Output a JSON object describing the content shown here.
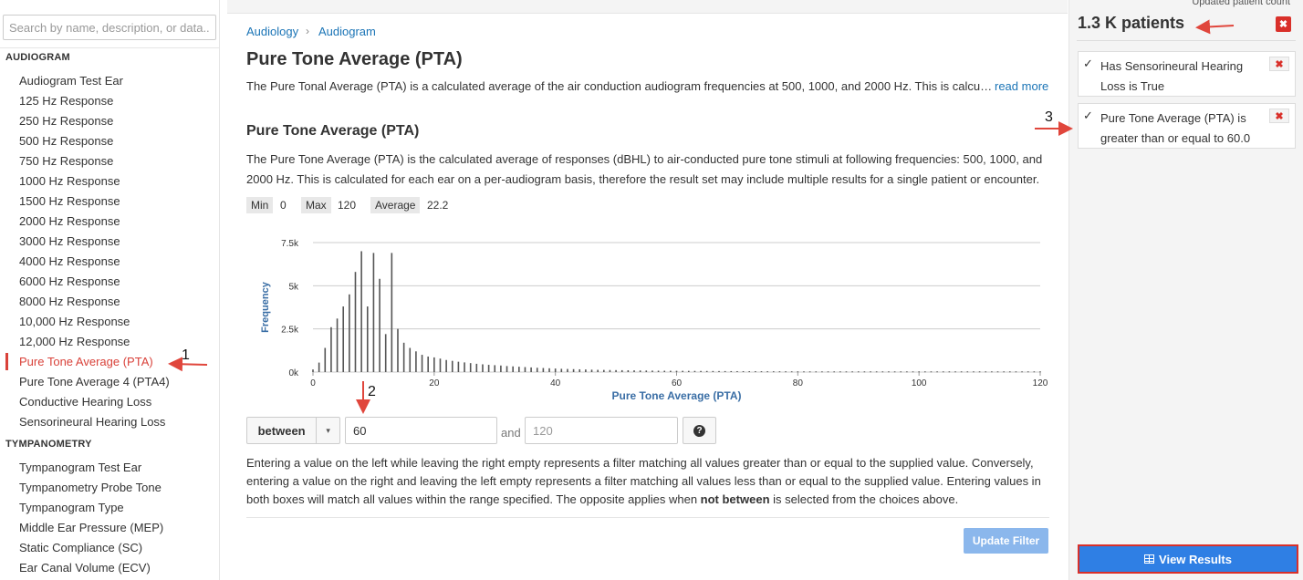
{
  "sidebar": {
    "search_placeholder": "Search by name, description, or data...",
    "sections": [
      {
        "title": "AUDIOGRAM",
        "items": [
          "Audiogram Test Ear",
          "125 Hz Response",
          "250 Hz Response",
          "500 Hz Response",
          "750 Hz Response",
          "1000 Hz Response",
          "1500 Hz Response",
          "2000 Hz Response",
          "3000 Hz Response",
          "4000 Hz Response",
          "6000 Hz Response",
          "8000 Hz Response",
          "10,000 Hz Response",
          "12,000 Hz Response",
          "Pure Tone Average (PTA)",
          "Pure Tone Average 4 (PTA4)",
          "Conductive Hearing Loss",
          "Sensorineural Hearing Loss"
        ]
      },
      {
        "title": "TYMPANOMETRY",
        "items": [
          "Tympanogram Test Ear",
          "Tympanometry Probe Tone",
          "Tympanogram Type",
          "Middle Ear Pressure (MEP)",
          "Static Compliance (SC)",
          "Ear Canal Volume (ECV)"
        ]
      }
    ],
    "active_item": "Pure Tone Average (PTA)"
  },
  "main": {
    "breadcrumb": [
      "Audiology",
      "Audiogram"
    ],
    "breadcrumb_sep": "›",
    "title": "Pure Tone Average (PTA)",
    "summary": "The Pure Tonal Average (PTA) is a calculated average of the air conduction audiogram frequencies at 500, 1000, and 2000 Hz. This is calcu…",
    "read_more": "read more",
    "section_title": "Pure Tone Average (PTA)",
    "description": "The Pure Tone Average (PTA) is the calculated average of responses (dBHL) to air-conducted pure tone stimuli at following frequencies: 500, 1000, and 2000 Hz. This is calculated for each ear on a per-audiogram basis, therefore the result set may include multiple results for a single patient or encounter.",
    "stats": {
      "min_label": "Min",
      "min_value": "0",
      "max_label": "Max",
      "max_value": "120",
      "avg_label": "Average",
      "avg_value": "22.2"
    },
    "filter": {
      "operator": "between",
      "caret": "▾",
      "low_value": "60",
      "high_placeholder": "120",
      "and_label": "and",
      "help_icon": "?"
    },
    "help_text_before": "Entering a value on the left while leaving the right empty represents a filter matching all values greater than or equal to the supplied value. Conversely, entering a value on the right and leaving the left empty represents a filter matching all values less than or equal to the supplied value. Entering values in both boxes will match all values within the range specified. The opposite applies when ",
    "help_text_bold": "not between",
    "help_text_after": " is selected from the choices above.",
    "update_button": "Update Filter"
  },
  "chart_data": {
    "type": "bar",
    "xlabel": "Pure Tone Average (PTA)",
    "ylabel": "Frequency",
    "xlim": [
      0,
      120
    ],
    "ylim": [
      0,
      7500
    ],
    "xticks": [
      0,
      20,
      40,
      60,
      80,
      100,
      120
    ],
    "yticks": [
      0,
      2500,
      5000,
      7500
    ],
    "ytick_labels": [
      "0k",
      "2.5k",
      "5k",
      "7.5k"
    ],
    "grid": true,
    "colors": {
      "bars": "#555555",
      "axis_label": "#3a6ea5",
      "grid": "#cccccc"
    },
    "x": [
      0,
      1,
      2,
      3,
      4,
      5,
      6,
      7,
      8,
      9,
      10,
      11,
      12,
      13,
      14,
      15,
      16,
      17,
      18,
      19,
      20,
      21,
      22,
      23,
      24,
      25,
      26,
      27,
      28,
      29,
      30,
      31,
      32,
      33,
      34,
      35,
      36,
      37,
      38,
      39,
      40,
      41,
      42,
      43,
      44,
      45,
      46,
      47,
      48,
      49,
      50,
      51,
      52,
      53,
      54,
      55,
      56,
      57,
      58,
      59,
      60,
      61,
      62,
      63,
      64,
      65,
      66,
      67,
      68,
      69,
      70,
      71,
      72,
      73,
      74,
      75,
      76,
      77,
      78,
      79,
      80,
      81,
      82,
      83,
      84,
      85,
      86,
      87,
      88,
      89,
      90,
      91,
      92,
      93,
      94,
      95,
      96,
      97,
      98,
      99,
      100,
      101,
      102,
      103,
      104,
      105,
      106,
      107,
      108,
      109,
      110,
      111,
      112,
      113,
      114,
      115,
      116,
      117,
      118,
      119,
      120
    ],
    "values": [
      150,
      550,
      1400,
      2600,
      3100,
      3800,
      4500,
      5800,
      7000,
      3800,
      6900,
      5400,
      2200,
      6900,
      2500,
      1700,
      1400,
      1200,
      1000,
      900,
      850,
      780,
      700,
      650,
      600,
      560,
      520,
      480,
      450,
      420,
      400,
      380,
      350,
      330,
      310,
      290,
      270,
      250,
      235,
      220,
      205,
      190,
      180,
      170,
      160,
      150,
      140,
      130,
      125,
      120,
      115,
      110,
      105,
      100,
      95,
      90,
      85,
      80,
      78,
      76,
      74,
      72,
      70,
      68,
      66,
      64,
      62,
      60,
      58,
      56,
      54,
      52,
      50,
      50,
      48,
      47,
      46,
      45,
      44,
      43,
      42,
      41,
      40,
      40,
      40,
      40,
      40,
      40,
      40,
      40,
      40,
      40,
      40,
      40,
      40,
      40,
      40,
      40,
      40,
      40,
      40,
      40,
      40,
      40,
      40,
      40,
      40,
      40,
      40,
      40,
      40,
      40,
      40,
      40,
      40,
      40,
      40,
      40,
      40,
      40,
      40
    ],
    "bar_x": [
      0,
      1,
      2,
      3,
      4,
      5,
      6,
      7,
      8,
      9,
      10,
      11,
      12,
      13,
      14,
      15,
      16,
      17,
      18,
      19,
      20,
      21,
      22,
      23,
      24,
      25,
      26,
      27,
      28,
      29,
      30,
      31,
      32,
      33,
      34,
      35,
      36,
      37,
      38,
      39,
      40,
      41,
      42,
      43,
      44,
      45,
      46,
      47,
      48,
      49,
      50,
      51,
      52,
      53,
      54,
      55,
      56,
      57,
      58,
      59,
      60,
      61,
      62,
      63,
      64,
      65,
      66,
      67,
      68,
      69,
      70,
      71,
      72,
      73,
      74,
      75,
      76,
      77,
      78,
      79,
      80,
      81,
      82,
      83,
      84,
      85,
      86,
      87,
      88,
      89,
      90,
      91,
      92,
      93,
      94,
      95,
      96,
      97,
      98,
      99,
      100,
      101,
      102,
      103,
      104,
      105,
      106,
      107,
      108,
      109,
      110,
      111,
      112,
      113,
      114,
      115,
      116,
      117,
      118,
      119,
      120
    ]
  },
  "right": {
    "updated_label": "Updated patient count",
    "count": "1.3 K patients",
    "clear_icon": "✖",
    "filters": [
      {
        "check": "✓",
        "text": "Has Sensorineural Hearing Loss is True",
        "remove": "✖"
      },
      {
        "check": "✓",
        "text": "Pure Tone Average (PTA) is greater than or equal to 60.0",
        "remove": "✖"
      }
    ],
    "view_results": "View Results"
  },
  "annotations": {
    "a1": "1",
    "a2": "2",
    "a3": "3",
    "arrow_color": "#e0463c"
  }
}
